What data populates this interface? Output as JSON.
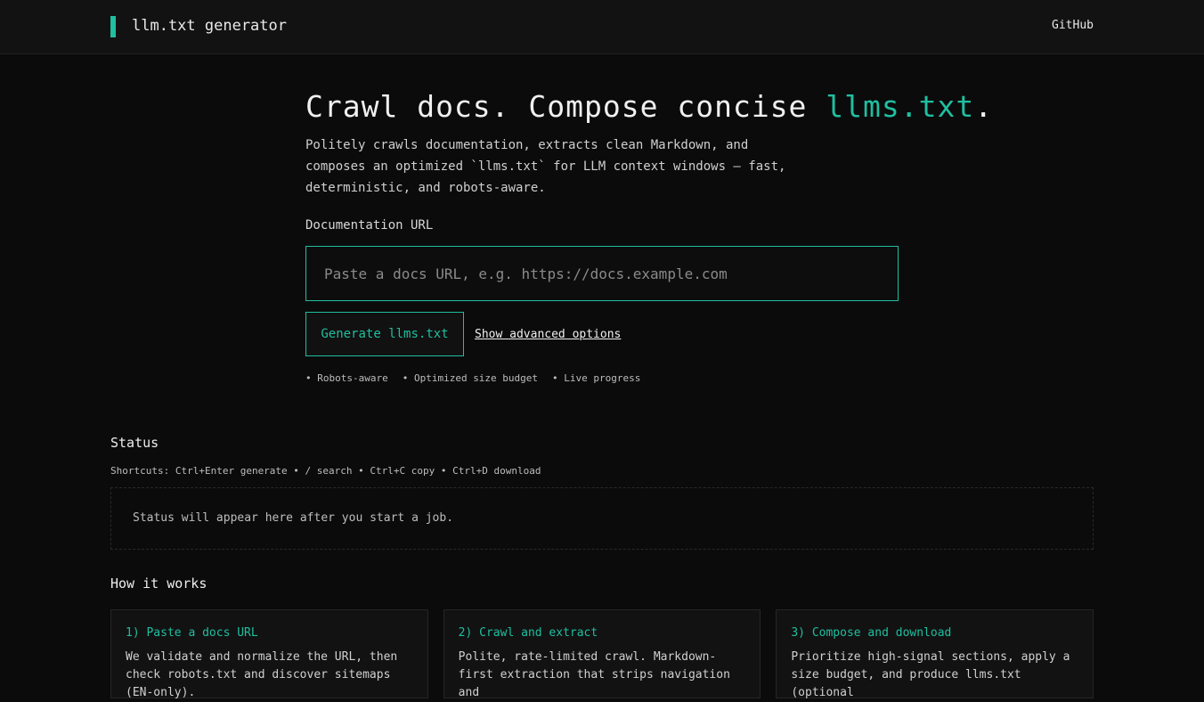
{
  "header": {
    "brand": "llm.txt generator",
    "github": "GitHub"
  },
  "hero": {
    "title_prefix": "Crawl docs. Compose concise ",
    "title_accent": "llms.txt",
    "title_suffix": ".",
    "subtitle": "Politely crawls documentation, extracts clean Markdown, and composes an optimized `llms.txt` for LLM context windows — fast, deterministic, and robots-aware.",
    "url_label": "Documentation URL",
    "url_placeholder": "Paste a docs URL, e.g. https://docs.example.com",
    "url_value": "",
    "generate": "Generate llms.txt",
    "advanced": "Show advanced options",
    "features": [
      "• Robots-aware",
      "• Optimized size budget",
      "• Live progress"
    ]
  },
  "status": {
    "title": "Status",
    "shortcuts": "Shortcuts: Ctrl+Enter generate • / search • Ctrl+C copy • Ctrl+D download",
    "message": "Status will appear here after you start a job."
  },
  "how": {
    "title": "How it works",
    "cards": [
      {
        "title": "1) Paste a docs URL",
        "body": "We validate and normalize the URL, then check robots.txt and discover sitemaps (EN-only)."
      },
      {
        "title": "2) Crawl and extract",
        "body": "Polite, rate-limited crawl. Markdown-first extraction that strips navigation and"
      },
      {
        "title": "3) Compose and download",
        "body": "Prioritize high-signal sections, apply a size budget, and produce llms.txt (optional"
      }
    ]
  },
  "colors": {
    "accent": "#1fbfa0"
  }
}
